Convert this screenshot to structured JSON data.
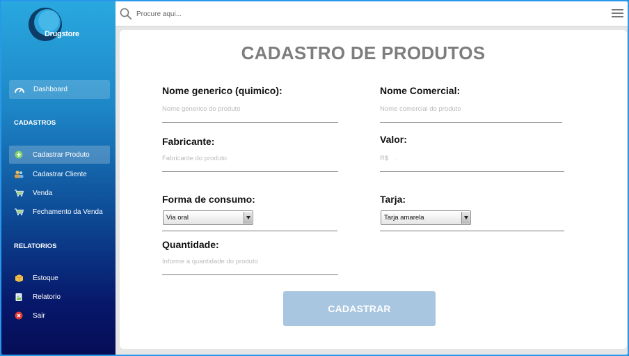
{
  "app": {
    "logo_text": "Drugstore"
  },
  "sidebar": {
    "dashboard": "Dashboard",
    "sections": {
      "cadastros": "CADASTROS",
      "relatorios": "RELATORIOS"
    },
    "cadastros_items": [
      {
        "label": "Cadastrar Produto",
        "icon": "plus-circle-icon",
        "active": true
      },
      {
        "label": "Cadastrar Cliente",
        "icon": "users-icon",
        "active": false
      },
      {
        "label": "Venda",
        "icon": "cart-icon",
        "active": false
      },
      {
        "label": "Fechamento da Venda",
        "icon": "cart-check-icon",
        "active": false
      }
    ],
    "relatorios_items": [
      {
        "label": "Estoque",
        "icon": "box-icon"
      },
      {
        "label": "Relatorio",
        "icon": "report-icon"
      },
      {
        "label": "Sair",
        "icon": "close-circle-icon"
      }
    ]
  },
  "search": {
    "placeholder": "Procure aqui..."
  },
  "form": {
    "title": "CADASTRO DE PRODUTOS",
    "nome_generico": {
      "label": "Nome generico (quimico):",
      "placeholder": "Nome generico do produto"
    },
    "nome_comercial": {
      "label": "Nome Comercial:",
      "placeholder": "Nome comercial do produto"
    },
    "fabricante": {
      "label": "Fabricante:",
      "placeholder": "Fabricante do produto"
    },
    "valor": {
      "label": "Valor:",
      "placeholder": "R$    ."
    },
    "forma_consumo": {
      "label": "Forma de consumo:",
      "selected": "Via oral"
    },
    "tarja": {
      "label": "Tarja:",
      "selected": "Tarja amarela"
    },
    "quantidade": {
      "label": "Quantidade:",
      "placeholder": "Informe a quantidade do produto"
    },
    "submit_label": "CADASTRAR"
  },
  "colors": {
    "sidebar_top": "#29a8df",
    "sidebar_bottom": "#050d55",
    "title": "#7d7d7d",
    "button": "#a8c6e0"
  }
}
